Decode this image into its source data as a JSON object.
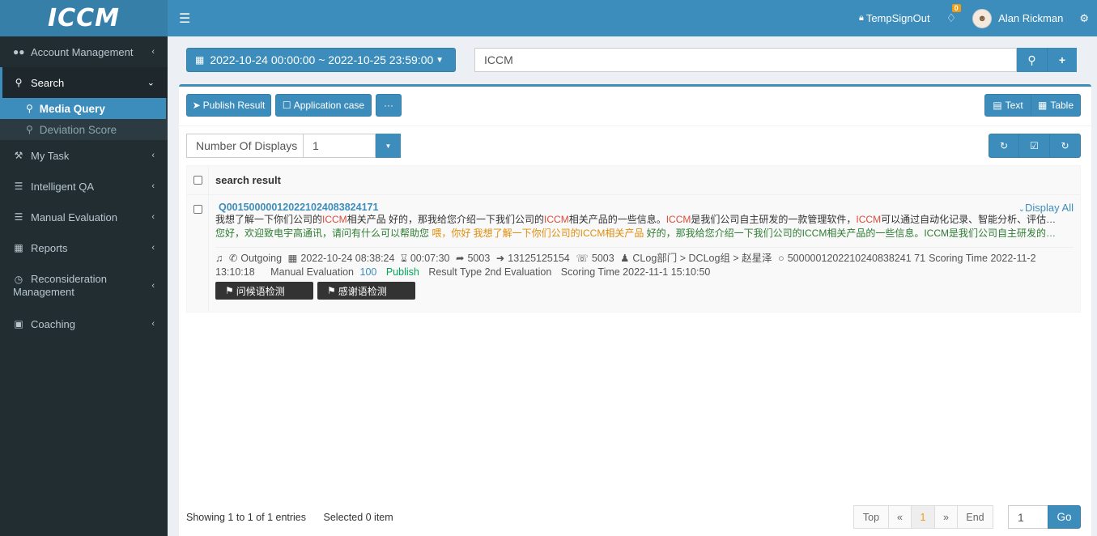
{
  "app": {
    "logo": "ICCM"
  },
  "header": {
    "signout": "TempSignOut",
    "notifications": "0",
    "user": "Alan Rickman"
  },
  "sidebar": {
    "items": [
      {
        "label": "Account Management",
        "icon": "users-icon"
      },
      {
        "label": "Search",
        "icon": "search-icon"
      },
      {
        "label": "My Task",
        "icon": "wrench-icon"
      },
      {
        "label": "Intelligent QA",
        "icon": "list-icon"
      },
      {
        "label": "Manual Evaluation",
        "icon": "list-icon"
      },
      {
        "label": "Reports",
        "icon": "table-icon"
      },
      {
        "label": "Reconsideration Management",
        "icon": "clock-icon"
      },
      {
        "label": "Coaching",
        "icon": "book-icon"
      }
    ],
    "sub": [
      {
        "label": "Media Query"
      },
      {
        "label": "Deviation Score"
      }
    ]
  },
  "filters": {
    "daterange": "2022-10-24 00:00:00 ~ 2022-10-25 23:59:00",
    "search": "ICCM"
  },
  "toolbar": {
    "publish": "Publish Result",
    "appcase": "Application case",
    "more": "···",
    "text": "Text",
    "table": "Table"
  },
  "display": {
    "label": "Number Of Displays",
    "value": "1"
  },
  "table": {
    "header": "search result",
    "display_all": "Display All"
  },
  "record": {
    "id": "Q00150000012022102408382417​1",
    "line1_parts": [
      "我想了解一下你们公司的",
      "ICCM",
      "相关产品 好的，那我给您介绍一下我们公司的",
      "ICCM",
      "相关产品的一些信息。",
      "ICCM",
      "是我们公司自主研发的一款管理软件，",
      "ICCM",
      "可以通过自动化记录、智能分析、评估每一次…"
    ],
    "line2_a": "您好，欢迎致电宇高通讯，请问有什么可以帮助您 ",
    "line2_b": "喂，你好 我想了解一下你们公司的ICCM相关产品",
    "line2_c": " 好的，那我给您介绍一下我们公司的ICCM相关产品的一些信息。ICCM是我们公司自主研发的一款管…",
    "direction": "Outgoing",
    "datetime": "2022-10-24 08:38:24",
    "duration": "00:07:30",
    "ext1": "5003",
    "phone": "13125125154",
    "ext2": "5003",
    "org": "CLog部门 > DCLog组 > 赵星泽",
    "call_id": "5000001202210240838241 71",
    "scoring1": "Scoring Time 2022-11-2",
    "scoring1_cont": "13:10:18",
    "eval_label": "Manual Evaluation",
    "eval_score": "100",
    "publish": "Publish",
    "result_type": "Result Type 2nd Evaluation",
    "scoring2": "Scoring Time 2022-11-1 15:10:50",
    "tags": [
      "问候语检测",
      "感谢语检测"
    ]
  },
  "footer": {
    "showing": "Showing 1 to 1 of 1 entries",
    "selected": "Selected 0 item",
    "pager": [
      "Top",
      "«",
      "1",
      "»",
      "End"
    ],
    "goto": "1",
    "go": "Go"
  }
}
